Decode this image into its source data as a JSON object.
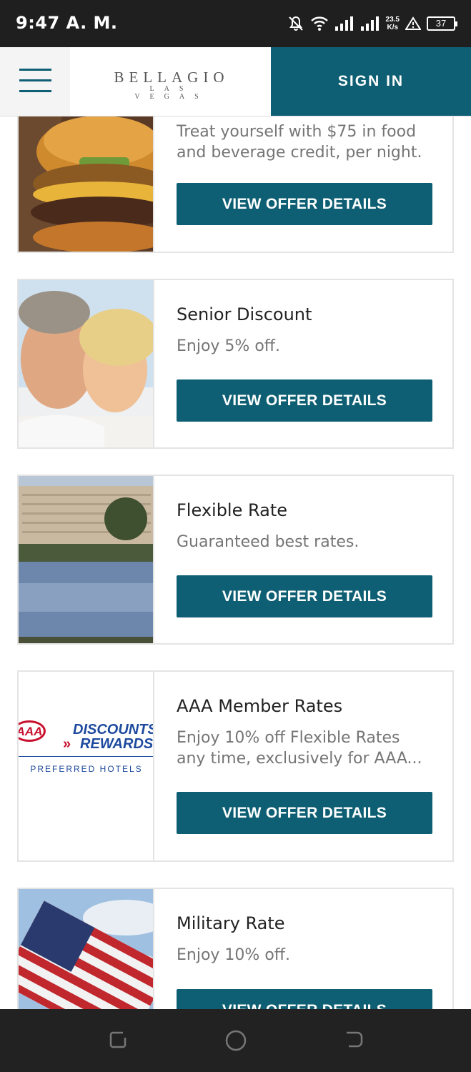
{
  "status": {
    "time": "9:47 A. M.",
    "net_speed_top": "23.5",
    "net_speed_bottom": "K/s",
    "battery": "37"
  },
  "header": {
    "logo_main": "BELLAGIO",
    "logo_sub": "LAS VEGAS",
    "signin_label": "SIGN IN"
  },
  "offers": [
    {
      "title": "",
      "description": "Treat yourself with $75 in food and beverage credit, per night.",
      "button": "VIEW OFFER DETAILS"
    },
    {
      "title": "Senior Discount",
      "description": "Enjoy 5% off.",
      "button": "VIEW OFFER DETAILS"
    },
    {
      "title": "Flexible Rate",
      "description": "Guaranteed best rates.",
      "button": "VIEW OFFER DETAILS"
    },
    {
      "title": "AAA Member Rates",
      "description": "Enjoy 10% off Flexible Rates any time, exclusively for AAA...",
      "button": "VIEW OFFER DETAILS",
      "logo_line1": "DISCOUNTS",
      "logo_line2": "REWARDS",
      "logo_brand": "AAA",
      "logo_footer": "PREFERRED HOTELS"
    },
    {
      "title": "Military Rate",
      "description": "Enjoy 10% off.",
      "button": "VIEW OFFER DETAILS"
    }
  ],
  "colors": {
    "accent": "#0e5f73",
    "status_bar": "#1f1f1f",
    "nav_bar": "#222222"
  }
}
